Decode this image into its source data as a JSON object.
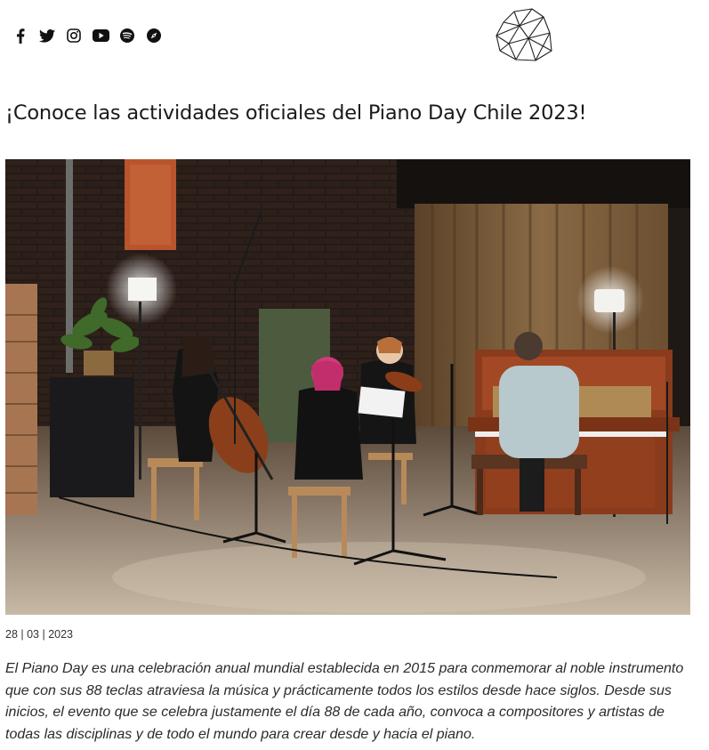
{
  "header": {
    "social": [
      {
        "name": "facebook-icon"
      },
      {
        "name": "twitter-icon"
      },
      {
        "name": "instagram-icon"
      },
      {
        "name": "youtube-icon"
      },
      {
        "name": "spotify-icon"
      },
      {
        "name": "compass-icon"
      }
    ]
  },
  "article": {
    "title": "¡Conoce las actividades oficiales del Piano Day Chile 2023!",
    "date": "28 | 03 | 2023",
    "paragraph": "El Piano Day es una celebración anual mundial establecida en 2015 para conmemorar al noble instrumento que con sus 88 teclas atraviesa la música y prácticamente todos los estilos desde hace siglos. Desde sus inicios, el evento que se celebra justamente el día 88 de cada año, convoca a compositores y artistas de todas las disciplinas y de todo el mundo para crear desde y hacia el piano."
  },
  "colors": {
    "text": "#1a1a1a",
    "curtain": "#8a6a45",
    "brick": "#3a2a22",
    "piano": "#8a3b1c"
  }
}
